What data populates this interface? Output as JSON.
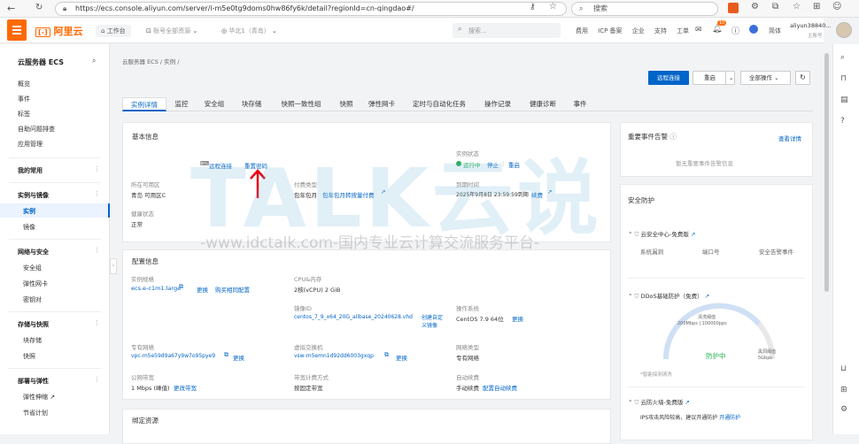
{
  "browser": {
    "url": "https://ecs.console.aliyun.com/server/i-m5e0tg9doms0hw86fy6k/detail?regionId=cn-qingdao#/",
    "search_placeholder": "搜索"
  },
  "header": {
    "logo": "阿里云",
    "workbench": "工作台",
    "account_selector": "账号全部资源",
    "region": "华北1（青岛）",
    "search_placeholder": "搜索...",
    "nav": [
      "费用",
      "ICP 备案",
      "企业",
      "支持",
      "工单"
    ],
    "notification_count": "10",
    "lang": "简体",
    "user_name": "aliyun38840...",
    "user_role": "主账号"
  },
  "sidebar": {
    "title": "云服务器 ECS",
    "items": [
      "概览",
      "事件",
      "标签",
      "自助问题排查",
      "应用管理"
    ],
    "groups": [
      {
        "label": "我的常用",
        "items": []
      },
      {
        "label": "实例与镜像",
        "items": [
          "实例",
          "镜像"
        ]
      },
      {
        "label": "网络与安全",
        "items": [
          "安全组",
          "弹性网卡",
          "密钥对"
        ]
      },
      {
        "label": "存储与快照",
        "items": [
          "块存储",
          "快照"
        ]
      },
      {
        "label": "部署与弹性",
        "items": [
          "弹性伸缩",
          "节省计划"
        ]
      }
    ]
  },
  "breadcrumb": "云服务器 ECS / 实例 /",
  "actions": {
    "remote": "远程连接",
    "restart": "重启",
    "all": "全部操作"
  },
  "tabs": [
    "实例详情",
    "监控",
    "安全组",
    "块存储",
    "快照一致性组",
    "快照",
    "弹性网卡",
    "定时与自动化任务",
    "操作记录",
    "健康诊断",
    "事件"
  ],
  "basic": {
    "title": "基本信息",
    "remote_link": "远程连接",
    "view_pwd": "重置密码",
    "region_label": "所在可用区",
    "region_value": "青岛 可用区C",
    "health_label": "健康状态",
    "health_value": "正常",
    "pay_label": "付费类型",
    "pay_value": "包年包月",
    "pay_link": "包年包月转按量付费",
    "status_label": "实例状态",
    "status_value": "运行中",
    "stop": "停止",
    "restart": "重启",
    "expire_label": "到期时间",
    "expire_value": "2025年9月8日 23:59:59到期",
    "renew": "续费"
  },
  "config": {
    "title": "配置信息",
    "spec_label": "实例规格",
    "spec_value": "ecs.e-c1m1.large",
    "spec_change": "更换",
    "spec_buy": "购买相同配置",
    "cpu_label": "CPU&内存",
    "cpu_value": "2核(vCPU)  2 GiB",
    "image_label": "镜像ID",
    "image_value": "centos_7_9_x64_20G_alibase_20240628.vhd",
    "image_create": "创建自定义镜像",
    "os_label": "操作系统",
    "os_value": "CentOS 7.9 64位",
    "os_change": "更换",
    "vpc_label": "专有网络",
    "vpc_value": "vpc-m5e59d9a67y9w7o95pye9",
    "vpc_change": "更换",
    "vsw_label": "虚拟交换机",
    "vsw_value": "vsw-m5emn1d92dd6003gxqp",
    "vsw_change": "更换",
    "net_label": "网络类型",
    "net_value": "专有网络",
    "bw_label": "公网带宽",
    "bw_value": "1 Mbps (峰值)",
    "bw_change": "更改带宽",
    "bwpay_label": "带宽计费方式",
    "bwpay_value": "按固定带宽",
    "renew_label": "自动续费",
    "renew_value": "手动续费",
    "renew_cfg": "配置自动续费"
  },
  "bind": {
    "title": "绑定资源"
  },
  "events": {
    "title": "重要事件告警",
    "view": "查看详情",
    "empty": "暂无重要事件告警信息"
  },
  "security": {
    "title": "安全防护",
    "center": "云安全中心-免费版",
    "vuln_label": "系统漏洞",
    "port_label": "端口号",
    "event_label": "安全告警事件",
    "ddos_title": "DDoS基础防护（免费）",
    "ddos_threshold": "清洗阈值",
    "ddos_bps": "200Mbps | 100000pps",
    "ddos_status": "防护中",
    "ddos_blackhole": "黑洞阈值",
    "ddos_bh_val": "5Gbps",
    "ddos_rule": "*智能探测清洗",
    "fw_title": "云防火墙-免费版",
    "fw_tip": "IPS攻击风险较高，建议开通防护",
    "fw_link": "开通防护"
  },
  "watermark": {
    "brand": "TALK云说",
    "url": "-www.idctalk.com-国内专业云计算交流服务平台-"
  },
  "colors": {
    "accent": "#ff6a00",
    "link": "#0064c8",
    "primary_btn": "#0064c8",
    "running": "#21b351",
    "arrow": "#e60012"
  }
}
